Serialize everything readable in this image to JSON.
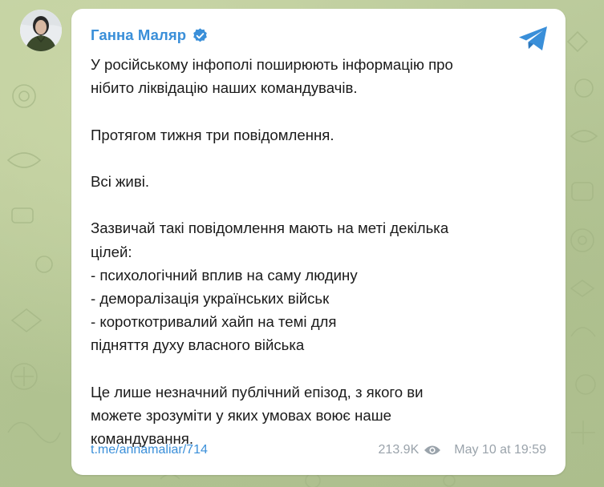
{
  "post": {
    "author": "Ганна Маляр",
    "paragraphs": [
      [
        "У російському інфополі поширюють інформацію про",
        "нібито ліквідацію наших командувачів."
      ],
      [
        "Протягом тижня три повідомлення."
      ],
      [
        "Всі живі."
      ],
      [
        "Зазвичай такі повідомлення мають на меті декілька",
        "цілей:",
        "- психологічний вплив на саму людину",
        "- деморалізація українських військ",
        "- короткотривалий хайп на темі для",
        "підняття духу власного війська"
      ],
      [
        "Це лише незначний публічний епізод, з якого ви",
        "можете зрозуміти у яких умовах воює наше",
        "командування."
      ]
    ],
    "link": "t.me/annamaliar/714",
    "views": "213.9K",
    "date": "May 10 at 19:59"
  },
  "colors": {
    "accent": "#3a8fd9",
    "text": "#1a1a1a",
    "muted": "#9aa3ab",
    "bubble": "#ffffff",
    "background": "#b7c89a"
  },
  "icons": {
    "avatar": "author-avatar",
    "verified": "verified-badge-icon",
    "share": "telegram-share-icon",
    "views": "eye-icon"
  }
}
